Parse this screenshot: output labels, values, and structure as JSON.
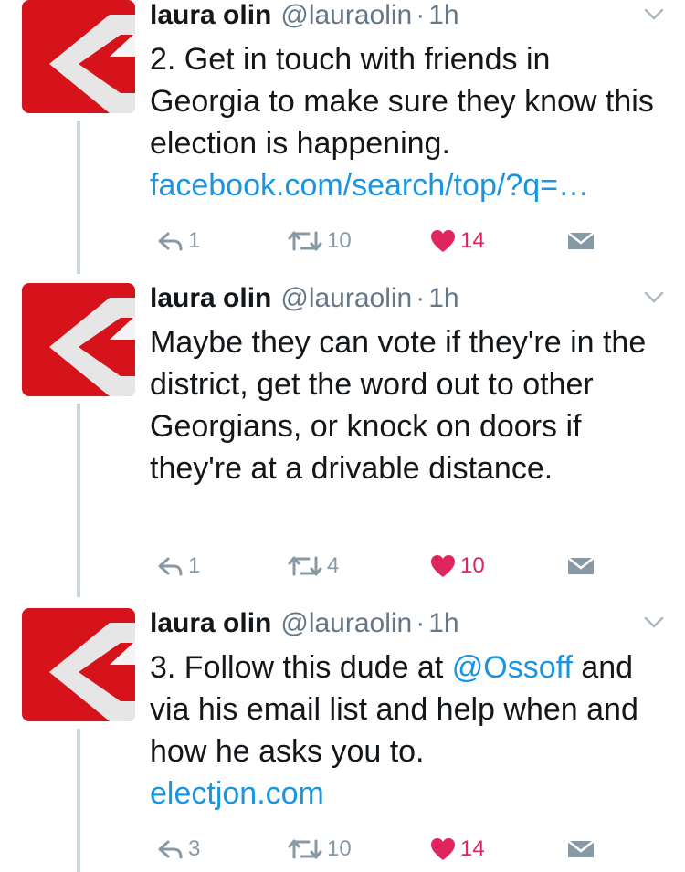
{
  "colors": {
    "avatar_red": "#d6131b",
    "avatar_gray": "#e6e6e6",
    "link": "#1b95e0",
    "heart": "#e0245e",
    "muted": "#8899a6",
    "thread_line": "#ccd6dd"
  },
  "tweets": [
    {
      "name": "laura olin",
      "handle": "@lauraolin",
      "separator": "·",
      "time": "1h",
      "text_plain": "2. Get in touch with friends in Georgia to make sure they know this election is happening.",
      "link": "facebook.com/search/top/?q=…",
      "replies": "1",
      "retweets": "10",
      "likes": "14"
    },
    {
      "name": "laura olin",
      "handle": "@lauraolin",
      "separator": "·",
      "time": "1h",
      "text_plain": "Maybe they can vote if they're in the district, get the word out to other Georgians, or knock on doors if they're at a drivable distance.",
      "replies": "1",
      "retweets": "4",
      "likes": "10"
    },
    {
      "name": "laura olin",
      "handle": "@lauraolin",
      "separator": "·",
      "time": "1h",
      "text_line1_prefix": "3. Follow this dude at",
      "mention": "@Ossoff",
      "text_rest": "and via his email list and help when and how he asks you to.",
      "link": "electjon.com",
      "replies": "3",
      "retweets": "10",
      "likes": "14"
    }
  ]
}
